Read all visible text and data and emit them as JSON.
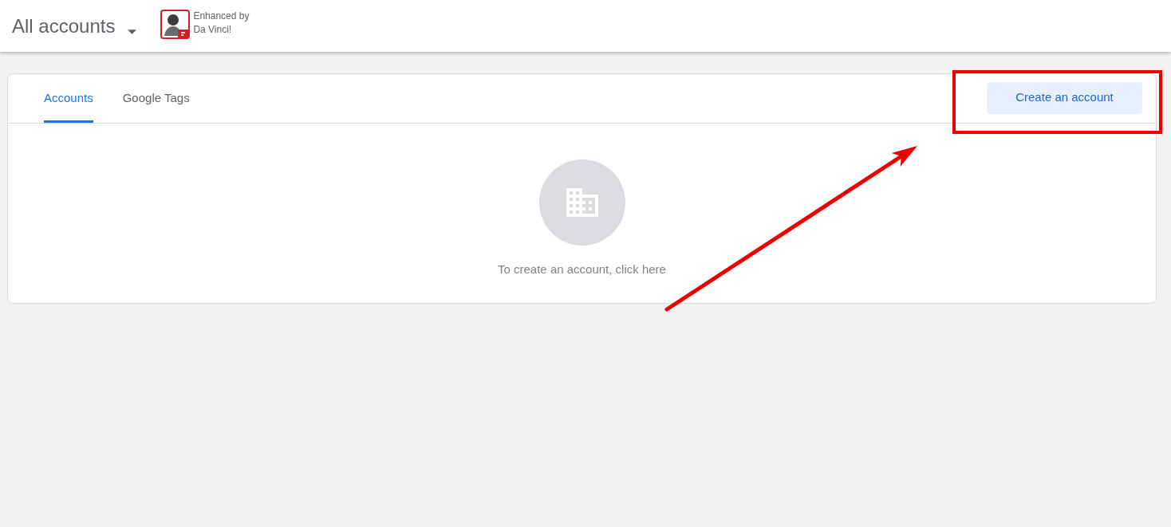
{
  "header": {
    "title": "All accounts",
    "badge_lines": [
      "Enhanced by",
      "Da Vinci!"
    ]
  },
  "tabs": [
    {
      "label": "Accounts",
      "selected": true
    },
    {
      "label": "Google Tags",
      "selected": false
    }
  ],
  "create_button": {
    "label": "Create an account",
    "highlighted": true
  },
  "empty_state": {
    "message": "To create an account, click here"
  },
  "annotation_arrow": true
}
